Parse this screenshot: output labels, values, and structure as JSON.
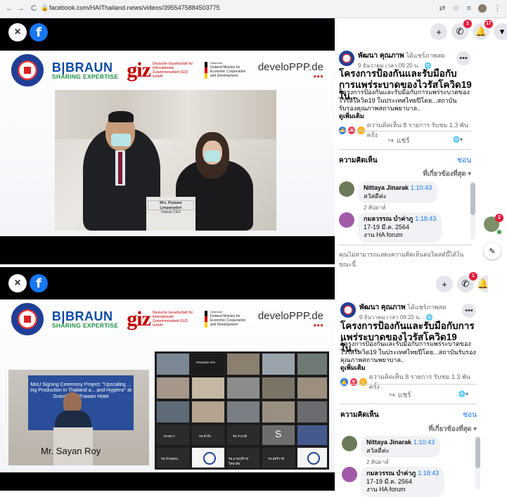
{
  "browser": {
    "back": "←",
    "forward": "→",
    "reload": "C",
    "url": "facebook.com/HAIThailand.news/videos/3955475884503775"
  },
  "header": {
    "messenger_badge": "1",
    "notifications_badge_top": "17"
  },
  "slide": {
    "bbraun_name": "B|BRAUN",
    "bbraun_tagline": "SHARING EXPERTISE",
    "giz_mark": "giz",
    "giz_text": "Deutsche Gesellschaft für Internationale Zusammenarbeit (GIZ) GmbH",
    "bmz_head": "Ostendorf",
    "bmz_text": "Federal Ministry for Economic Cooperation and Development",
    "developpp": "develoPPP.de",
    "speaker_sign_top": "Mrs. Piyawan Limpanyalert",
    "speaker_sign_bottom": "Deputy CEO",
    "speaker_bottom": "Mr. Sayan Roy",
    "banner_text": "MoU Signing Ceremony Project: \"Upscaling ... ing Production in Thailand a... and Hygiene\" at Grand Hy... Erawan Hotel"
  },
  "zoom_grid": {
    "top_label": "Precision HAI",
    "names_row1": [
      "",
      "Precision HAI",
      ""
    ],
    "names_row4": [
      "ดวงดาว",
      "รพ.ตัวใจ",
      "รพ.ราบวดี",
      "S",
      ""
    ],
    "names_row5": [
      "รพ.บ้านดอน",
      "",
      "รพ.ลาดบุรีราชวิทยาลัย",
      "รพ.สตรีวานี",
      ""
    ]
  },
  "post": {
    "author": "พัฒนา คุณภาพ",
    "shared": "ได้แชร์ภาพสด",
    "time": "9 ธันวาคม เวลา 09:20 น. · 🌐",
    "title": "โครงการป้องกันและรับมือกับการแพร่ระบาดของไวรัสโควิด19 ใน...",
    "desc": "โครงการป้องกันและรับมือกับการแพร่ระบาดของไวรัสโควิด19 ในประเทศไทยปีโดย...สถาบันรับรองคุณภาพสถานพยาบาล..",
    "see_more": "ดูเพิ่มเติม",
    "reactions": "ความคิดเห็น 8 รายการ รับชม 1.3 พัน ครั้ง",
    "share": "แชร์",
    "comments_label": "ความคิดเห็น",
    "hide": "ซ่อน",
    "sort": "ที่เกี่ยวข้องที่สุด",
    "comments": [
      {
        "name": "Nittaya Jinarak",
        "timestamp": "1:10:43",
        "text": "สวัสดีค่ะ",
        "meta": "2 สัปดาห์"
      },
      {
        "name": "กมลวรรณ บำค่าภู",
        "timestamp": "1:18:43",
        "text": "17-19 มี.ค. 2564",
        "text2": "งาน HA forum",
        "meta": ""
      }
    ],
    "footer": "คุณไม่สามารถแสดงความคิดเห็นต่อโพสต์นี้ได้ในขณะนี้"
  },
  "chat": {
    "avatar_badge": "2"
  }
}
